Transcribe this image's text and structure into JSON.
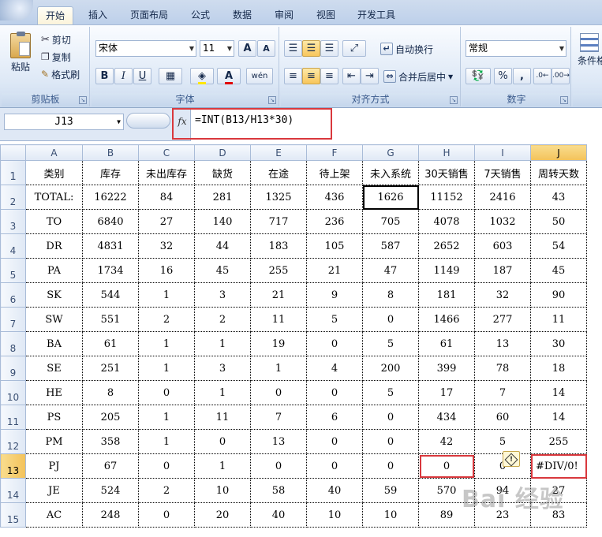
{
  "tabs": [
    "开始",
    "插入",
    "页面布局",
    "公式",
    "数据",
    "审阅",
    "视图",
    "开发工具"
  ],
  "clipboard": {
    "paste": "粘贴",
    "cut": "剪切",
    "copy": "复制",
    "format_painter": "格式刷",
    "label": "剪贴板"
  },
  "font": {
    "name": "宋体",
    "size": "11",
    "bold": "B",
    "italic": "I",
    "underline": "U",
    "grow": "A",
    "shrink": "A",
    "pinyin": "wén",
    "label": "字体"
  },
  "alignment": {
    "wrap": "自动换行",
    "merge": "合并后居中",
    "label": "对齐方式"
  },
  "number": {
    "format": "常规",
    "percent": "%",
    "comma": ",",
    "label": "数字"
  },
  "styles": {
    "conditional": "条件格"
  },
  "formula_bar": {
    "name_box": "J13",
    "fx": "fx",
    "formula": "=INT(B13/H13*30)"
  },
  "columns": [
    "A",
    "B",
    "C",
    "D",
    "E",
    "F",
    "G",
    "H",
    "I",
    "J"
  ],
  "header_row": [
    "类别",
    "库存",
    "未出库存",
    "缺货",
    "在途",
    "待上架",
    "未入系统",
    "30天销售",
    "7天销售",
    "周转天数"
  ],
  "rows": [
    [
      "TOTAL:",
      "16222",
      "84",
      "281",
      "1325",
      "436",
      "1626",
      "11152",
      "2416",
      "43"
    ],
    [
      "TO",
      "6840",
      "27",
      "140",
      "717",
      "236",
      "705",
      "4078",
      "1032",
      "50"
    ],
    [
      "DR",
      "4831",
      "32",
      "44",
      "183",
      "105",
      "587",
      "2652",
      "603",
      "54"
    ],
    [
      "PA",
      "1734",
      "16",
      "45",
      "255",
      "21",
      "47",
      "1149",
      "187",
      "45"
    ],
    [
      "SK",
      "544",
      "1",
      "3",
      "21",
      "9",
      "8",
      "181",
      "32",
      "90"
    ],
    [
      "SW",
      "551",
      "2",
      "2",
      "11",
      "5",
      "0",
      "1466",
      "277",
      "11"
    ],
    [
      "BA",
      "61",
      "1",
      "1",
      "19",
      "0",
      "5",
      "61",
      "13",
      "30"
    ],
    [
      "SE",
      "251",
      "1",
      "3",
      "1",
      "4",
      "200",
      "399",
      "78",
      "18"
    ],
    [
      "HE",
      "8",
      "0",
      "1",
      "0",
      "0",
      "5",
      "17",
      "7",
      "14"
    ],
    [
      "PS",
      "205",
      "1",
      "11",
      "7",
      "6",
      "0",
      "434",
      "60",
      "14"
    ],
    [
      "PM",
      "358",
      "1",
      "0",
      "13",
      "0",
      "0",
      "42",
      "5",
      "255"
    ],
    [
      "PJ",
      "67",
      "0",
      "1",
      "0",
      "0",
      "0",
      "0",
      "0",
      "#DIV/0!"
    ],
    [
      "JE",
      "524",
      "2",
      "10",
      "58",
      "40",
      "59",
      "570",
      "94",
      "27"
    ],
    [
      "AC",
      "248",
      "0",
      "20",
      "40",
      "10",
      "10",
      "89",
      "23",
      "83"
    ]
  ],
  "row_numbers": [
    "1",
    "2",
    "3",
    "4",
    "5",
    "6",
    "7",
    "8",
    "9",
    "10",
    "11",
    "12",
    "13",
    "14",
    "15"
  ],
  "error_icon": "!",
  "watermark": "Bai 经验"
}
